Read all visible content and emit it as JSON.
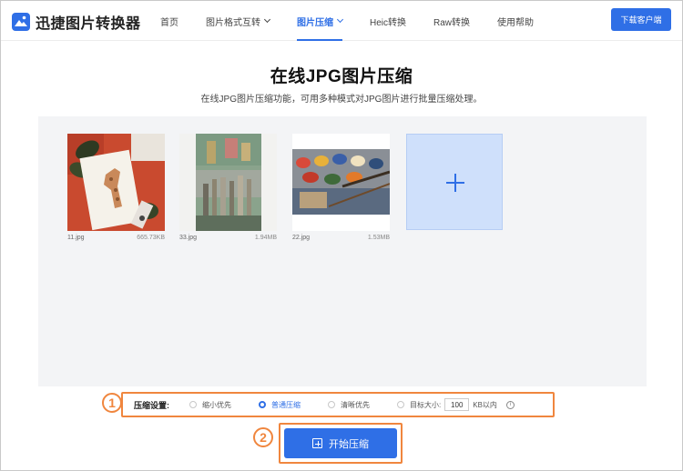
{
  "app": {
    "title": "迅捷图片转换器"
  },
  "nav": {
    "items": [
      {
        "label": "首页"
      },
      {
        "label": "图片格式互转"
      },
      {
        "label": "图片压缩"
      },
      {
        "label": "Heic转换"
      },
      {
        "label": "Raw转换"
      },
      {
        "label": "使用帮助"
      }
    ],
    "download_label": "下载客户端"
  },
  "main": {
    "title": "在线JPG图片压缩",
    "subtitle": "在线JPG图片压缩功能，可用多种模式对JPG图片进行批量压缩处理。"
  },
  "files": [
    {
      "name": "11.jpg",
      "size": "665.73KB"
    },
    {
      "name": "33.jpg",
      "size": "1.94MB"
    },
    {
      "name": "22.jpg",
      "size": "1.53MB"
    }
  ],
  "settings": {
    "label": "压缩设置:",
    "options": [
      {
        "label": "缩小优先",
        "selected": false
      },
      {
        "label": "普通压缩",
        "selected": true
      },
      {
        "label": "清晰优先",
        "selected": false
      }
    ],
    "target_label": "目标大小:",
    "target_value": "100",
    "target_unit": "KB以内"
  },
  "annotations": {
    "one": "1",
    "two": "2"
  },
  "start_label": "开始压缩",
  "colors": {
    "accent": "#2f6fe6",
    "highlight": "#f0863e"
  }
}
